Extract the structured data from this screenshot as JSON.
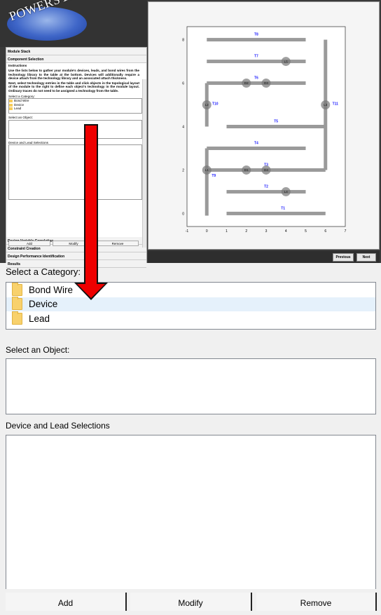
{
  "logo": {
    "text": "POWERSYNTH"
  },
  "sidebar": {
    "module_stack": "Module Stack",
    "component_selection": "Component Selection",
    "instructions_head": "Instructions",
    "instructions_p1": "Use the lists below to gather your module's devices, leads, and bond wires from the technology library to the table at the bottom. Devices will additionally require a device attach from the technology library and an associated attach thickness.",
    "instructions_p2": "Next, select technology entries in the table and click objects in the topological layout of the module to the right to define each object's technology in the module layout. Ordinary traces do not need to be assigned a technology from the table.",
    "select_category": "Select a Category:",
    "categories": [
      "Bond Wire",
      "Device",
      "Lead"
    ],
    "select_object": "Select an Object:",
    "device_lead": "Device and Lead Selections",
    "add": "Add",
    "modify": "Modify",
    "remove": "Remove",
    "sections": [
      "Design Variable Correlation",
      "Constraint Creation",
      "Design Performance Identification",
      "Results"
    ]
  },
  "layout_plot": {
    "x_ticks": [
      "-1",
      "0",
      "1",
      "2",
      "3",
      "4",
      "5",
      "6",
      "7"
    ],
    "y_ticks": [
      "0",
      "2",
      "4",
      "6",
      "8"
    ],
    "trace_labels": [
      "T1",
      "T2",
      "T3",
      "T4",
      "T5",
      "T6",
      "T7",
      "T8",
      "T9",
      "T10",
      "T11"
    ],
    "point_labels": [
      "L1",
      "L2",
      "L3",
      "L4",
      "L5",
      "D1",
      "D2",
      "D3",
      "D4"
    ],
    "label_color": "#1a1aff"
  },
  "nav": {
    "previous": "Previous",
    "next": "Next"
  },
  "panel": {
    "category_label": "Select a Category:",
    "categories": [
      {
        "label": "Bond Wire",
        "icon": "folder-icon"
      },
      {
        "label": "Device",
        "icon": "folder-icon"
      },
      {
        "label": "Lead",
        "icon": "folder-icon"
      }
    ],
    "selected_category": "Device",
    "object_label": "Select an Object:",
    "selections_label": "Device and Lead Selections",
    "add_label": "Add",
    "modify_label": "Modify",
    "remove_label": "Remove"
  },
  "colors": {
    "annotation_arrow": "#ee0000",
    "selection": "#e5f1fb",
    "folder": "#f8d16c"
  }
}
